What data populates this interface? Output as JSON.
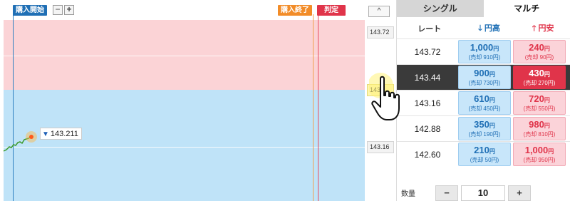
{
  "chart": {
    "badge_start": "購入開始",
    "badge_end": "購入終了",
    "badge_judge": "判定",
    "zoom_out": "−",
    "zoom_in": "+",
    "current_price": "143.211",
    "current_price_icon": "triangle-down-icon"
  },
  "axis": {
    "up_label": "^",
    "labels": [
      "143.72",
      "143",
      "143.16"
    ]
  },
  "panel": {
    "tabs": [
      "シングル",
      "マルチ"
    ],
    "active_tab": "マルチ",
    "header": {
      "rate": "レート",
      "high": "円高",
      "low": "円安"
    },
    "rows": [
      {
        "rate": "143.72",
        "high_price": "1,000",
        "high_sell": "(売却 910円)",
        "low_price": "240",
        "low_sell": "(売却 90円)"
      },
      {
        "rate": "143.44",
        "high_price": "900",
        "high_sell": "(売却 730円)",
        "low_price": "430",
        "low_sell": "(売却 270円)"
      },
      {
        "rate": "143.16",
        "high_price": "610",
        "high_sell": "(売却 450円)",
        "low_price": "720",
        "low_sell": "(売却 550円)"
      },
      {
        "rate": "142.88",
        "high_price": "350",
        "high_sell": "(売却 190円)",
        "low_price": "980",
        "low_sell": "(売却 810円)"
      },
      {
        "rate": "142.60",
        "high_price": "210",
        "high_sell": "(売却 50円)",
        "low_price": "1,000",
        "low_sell": "(売却 950円)"
      }
    ],
    "selected_rate": "143.44",
    "yen_unit": "円",
    "quantity": {
      "label": "数量",
      "minus": "−",
      "value": "10",
      "plus": "+"
    }
  },
  "colors": {
    "high_zone": "#fbd3d6",
    "low_zone": "#bfe3f8",
    "accent_blue": "#1f6fb5",
    "accent_red": "#e0344a",
    "badge_end": "#f28c28"
  }
}
